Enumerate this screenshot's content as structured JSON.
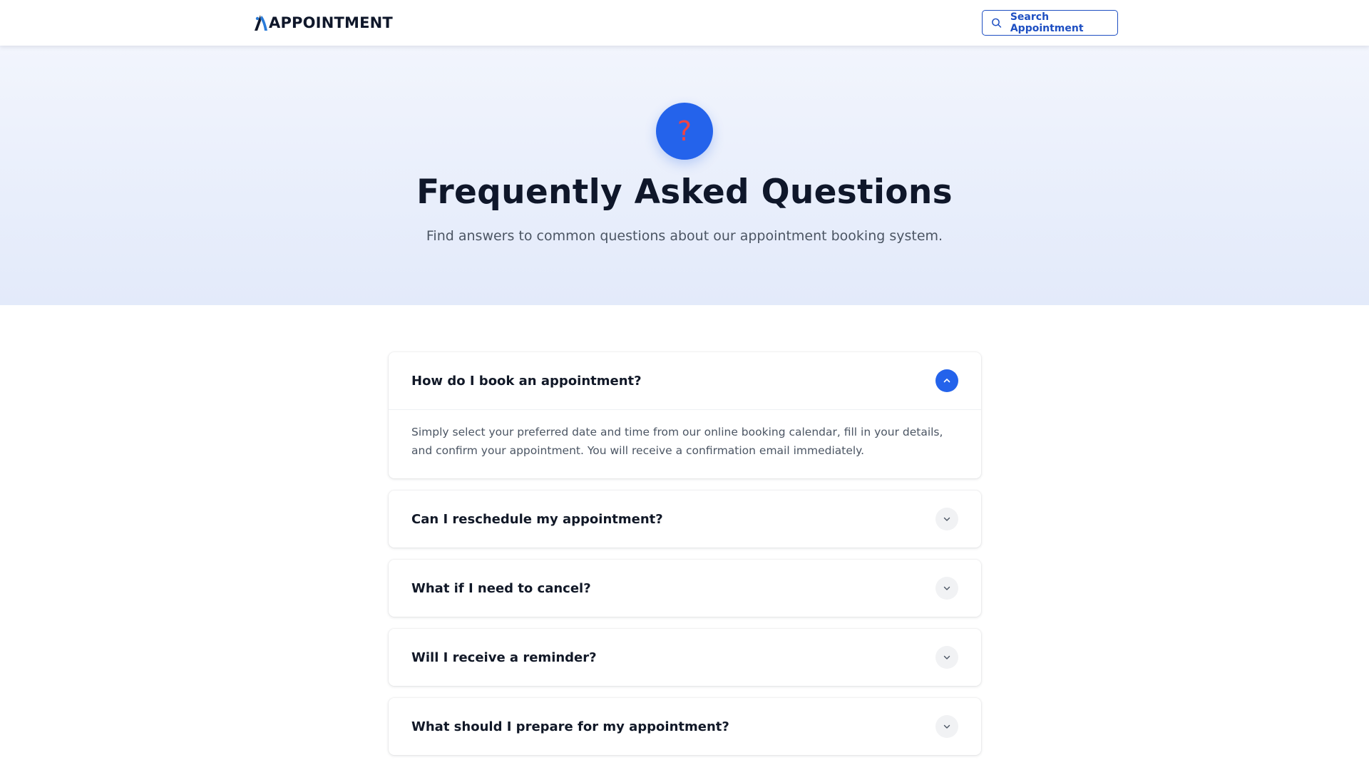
{
  "header": {
    "logo_text": "APPOINTMENT",
    "search_button_label": "Search Appointment",
    "search_icon": "search-icon"
  },
  "hero": {
    "icon": "question-mark-icon",
    "icon_glyph": "?",
    "title": "Frequently Asked Questions",
    "subtitle": "Find answers to common questions about our appointment booking system."
  },
  "faq": {
    "items": [
      {
        "question": "How do I book an appointment?",
        "answer": "Simply select your preferred date and time from our online booking calendar, fill in your details, and confirm your appointment. You will receive a confirmation email immediately.",
        "expanded": true
      },
      {
        "question": "Can I reschedule my appointment?",
        "expanded": false
      },
      {
        "question": "What if I need to cancel?",
        "expanded": false
      },
      {
        "question": "Will I receive a reminder?",
        "expanded": false
      },
      {
        "question": "What should I prepare for my appointment?",
        "expanded": false
      }
    ]
  },
  "colors": {
    "accent": "#2463eb",
    "header_button": "#1e4fc2",
    "hero_background": "#e8eefb",
    "question_mark": "#ef4444"
  }
}
